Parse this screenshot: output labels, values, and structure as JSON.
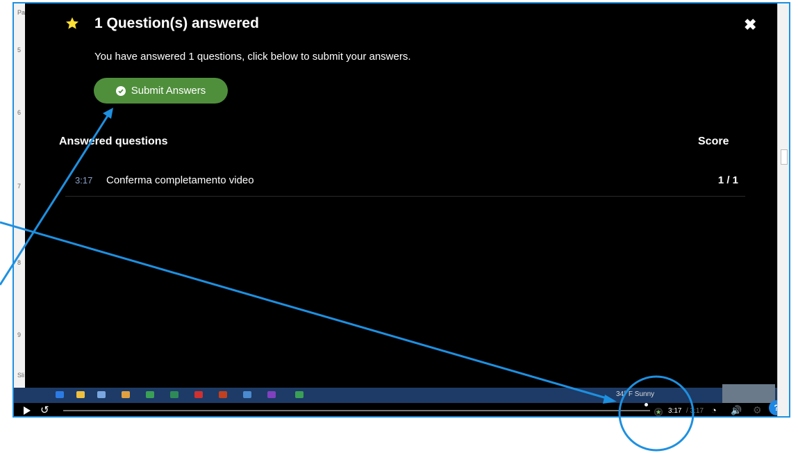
{
  "modal": {
    "title": "1 Question(s) answered",
    "description": "You have answered 1 questions, click below to submit your answers.",
    "submit_label": "Submit Answers",
    "close_symbol": "✖",
    "answered_header": "Answered questions",
    "score_header": "Score",
    "rows": [
      {
        "time": "3:17",
        "question": "Conferma completamento video",
        "score": "1 / 1"
      }
    ]
  },
  "player": {
    "current_time": "3:17",
    "duration_label": "/ 3:17",
    "help_label": "?",
    "progress": 0.99
  },
  "taskbar": {
    "label": "34° F Sunny"
  },
  "icons": [
    "star-icon",
    "close-icon",
    "check-circle-icon",
    "play-icon",
    "rewind-icon",
    "speed-icon",
    "volume-icon",
    "gear-icon",
    "help-icon"
  ],
  "colors": {
    "modal_bg": "#000000",
    "submit_button": "#4f8f3c",
    "star": "#ffe033",
    "annotation": "#1e90e0",
    "help_button": "#1e88e5"
  }
}
